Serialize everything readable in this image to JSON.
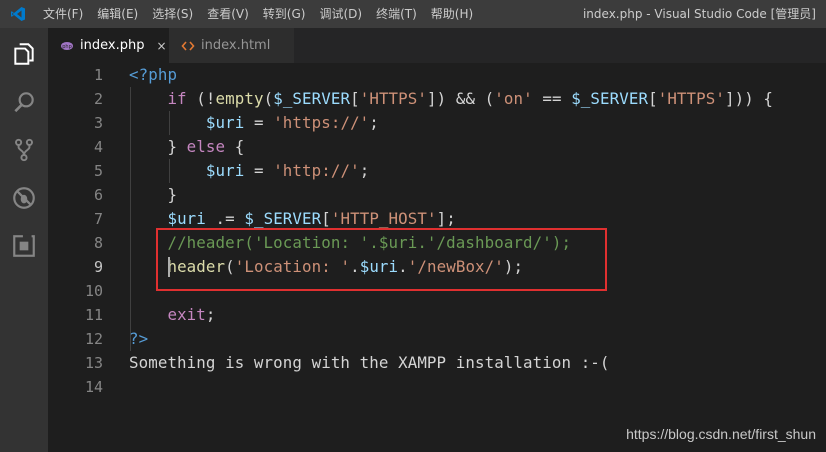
{
  "menu": [
    "文件(F)",
    "编辑(E)",
    "选择(S)",
    "查看(V)",
    "转到(G)",
    "调试(D)",
    "终端(T)",
    "帮助(H)"
  ],
  "window_title": "index.php - Visual Studio Code [管理员]",
  "tabs": [
    {
      "label": "index.php",
      "close": "×"
    },
    {
      "label": "index.html"
    }
  ],
  "colors": {
    "php_icon": "#a074c4",
    "html_icon": "#e37933",
    "highlight_box": "#e03030"
  },
  "lines": [
    {
      "n": "1",
      "tokens": [
        {
          "t": "<?php",
          "c": "pt"
        }
      ]
    },
    {
      "n": "2",
      "tokens": [
        {
          "t": "    if",
          "c": "kw"
        },
        {
          "t": " (!",
          "c": "txt"
        },
        {
          "t": "empty",
          "c": "fn"
        },
        {
          "t": "(",
          "c": "txt"
        },
        {
          "t": "$_SERVER",
          "c": "var"
        },
        {
          "t": "[",
          "c": "txt"
        },
        {
          "t": "'HTTPS'",
          "c": "str"
        },
        {
          "t": "]) && (",
          "c": "txt"
        },
        {
          "t": "'on'",
          "c": "str"
        },
        {
          "t": " == ",
          "c": "txt"
        },
        {
          "t": "$_SERVER",
          "c": "var"
        },
        {
          "t": "[",
          "c": "txt"
        },
        {
          "t": "'HTTPS'",
          "c": "str"
        },
        {
          "t": "])) {",
          "c": "txt"
        }
      ]
    },
    {
      "n": "3",
      "tokens": [
        {
          "t": "        ",
          "c": "txt"
        },
        {
          "t": "$uri",
          "c": "var"
        },
        {
          "t": " = ",
          "c": "txt"
        },
        {
          "t": "'https://'",
          "c": "str"
        },
        {
          "t": ";",
          "c": "txt"
        }
      ]
    },
    {
      "n": "4",
      "tokens": [
        {
          "t": "    } ",
          "c": "txt"
        },
        {
          "t": "else",
          "c": "kw"
        },
        {
          "t": " {",
          "c": "txt"
        }
      ]
    },
    {
      "n": "5",
      "tokens": [
        {
          "t": "        ",
          "c": "txt"
        },
        {
          "t": "$uri",
          "c": "var"
        },
        {
          "t": " = ",
          "c": "txt"
        },
        {
          "t": "'http://'",
          "c": "str"
        },
        {
          "t": ";",
          "c": "txt"
        }
      ]
    },
    {
      "n": "6",
      "tokens": [
        {
          "t": "    }",
          "c": "txt"
        }
      ]
    },
    {
      "n": "7",
      "tokens": [
        {
          "t": "    ",
          "c": "txt"
        },
        {
          "t": "$uri",
          "c": "var"
        },
        {
          "t": " .= ",
          "c": "txt"
        },
        {
          "t": "$_SERVER",
          "c": "var"
        },
        {
          "t": "[",
          "c": "txt"
        },
        {
          "t": "'HTTP_HOST'",
          "c": "str"
        },
        {
          "t": "];",
          "c": "txt"
        }
      ]
    },
    {
      "n": "8",
      "tokens": [
        {
          "t": "    ",
          "c": "txt"
        },
        {
          "t": "//header('Location: '.$uri.'/dashboard/');",
          "c": "cm"
        }
      ]
    },
    {
      "n": "9",
      "tokens": [
        {
          "t": "    ",
          "c": "txt"
        },
        {
          "t": "header",
          "c": "fn"
        },
        {
          "t": "(",
          "c": "txt"
        },
        {
          "t": "'Location: '",
          "c": "str"
        },
        {
          "t": ".",
          "c": "txt"
        },
        {
          "t": "$uri",
          "c": "var"
        },
        {
          "t": ".",
          "c": "txt"
        },
        {
          "t": "'/newBox/'",
          "c": "str"
        },
        {
          "t": ");",
          "c": "txt"
        }
      ]
    },
    {
      "n": "10",
      "tokens": []
    },
    {
      "n": "11",
      "tokens": [
        {
          "t": "    ",
          "c": "txt"
        },
        {
          "t": "exit",
          "c": "kw"
        },
        {
          "t": ";",
          "c": "txt"
        }
      ]
    },
    {
      "n": "12",
      "tokens": [
        {
          "t": "?>",
          "c": "pt"
        }
      ]
    },
    {
      "n": "13",
      "tokens": [
        {
          "t": "Something is wrong with the XAMPP installation :-(",
          "c": "txt"
        }
      ]
    },
    {
      "n": "14",
      "tokens": []
    }
  ],
  "active_line": "9",
  "watermark": "https://blog.csdn.net/first_shun"
}
